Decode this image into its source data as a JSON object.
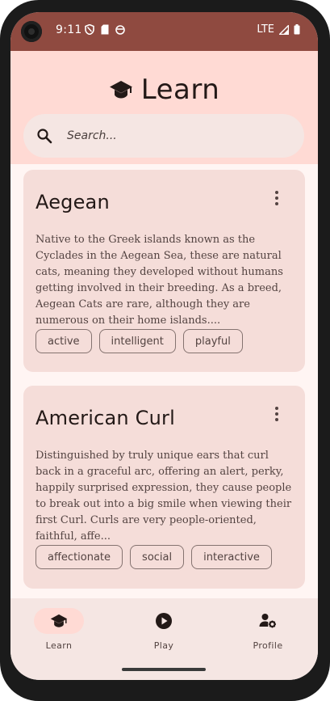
{
  "status_bar": {
    "time": "9:11",
    "network": "LTE"
  },
  "header": {
    "title": "Learn"
  },
  "search": {
    "placeholder": "Search..."
  },
  "breeds": [
    {
      "name": "Aegean",
      "description": "Native to the Greek islands known as the Cyclades in the Aegean Sea, these are natural cats, meaning they developed without humans getting involved in their breeding. As a breed, Aegean Cats are rare, although they are numerous on their home islands....",
      "tags": [
        "active",
        "intelligent",
        "playful"
      ]
    },
    {
      "name": "American Curl",
      "description": "Distinguished by truly unique ears that curl back in a graceful arc, offering an alert, perky, happily surprised expression, they cause people to break out into a big smile when viewing their first Curl. Curls are very people-oriented, faithful, affe...",
      "tags": [
        "affectionate",
        "social",
        "interactive"
      ]
    }
  ],
  "nav": {
    "items": [
      {
        "label": "Learn",
        "icon": "graduation-cap-icon",
        "active": true
      },
      {
        "label": "Play",
        "icon": "play-circle-icon",
        "active": false
      },
      {
        "label": "Profile",
        "icon": "person-settings-icon",
        "active": false
      }
    ]
  },
  "colors": {
    "status_bar": "#8f4a40",
    "header": "#ffdad4",
    "card": "#f5ddd9",
    "nav_active": "#ffdad4"
  }
}
